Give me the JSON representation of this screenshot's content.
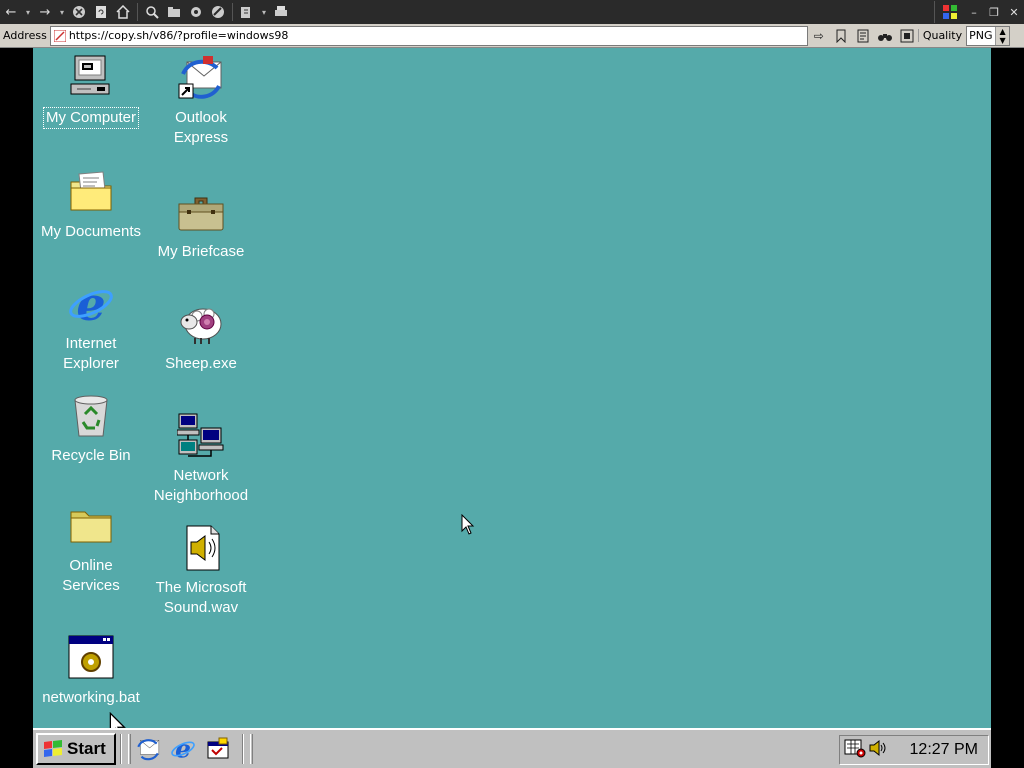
{
  "browser": {
    "address_label": "Address",
    "url": "https://copy.sh/v86/?profile=windows98",
    "quality_label": "Quality",
    "format_value": "PNG"
  },
  "desktop": {
    "icons": [
      {
        "label": "My Computer",
        "icon": "my-computer-icon"
      },
      {
        "label": "Outlook\nExpress",
        "icon": "outlook-express-icon"
      },
      {
        "label": "My Documents",
        "icon": "my-documents-icon"
      },
      {
        "label": "My Briefcase",
        "icon": "briefcase-icon"
      },
      {
        "label": "Internet\nExplorer",
        "icon": "internet-explorer-icon"
      },
      {
        "label": "Sheep.exe",
        "icon": "sheep-icon"
      },
      {
        "label": "Recycle Bin",
        "icon": "recycle-bin-icon"
      },
      {
        "label": "Network\nNeighborhood",
        "icon": "network-neighborhood-icon"
      },
      {
        "label": "Online\nServices",
        "icon": "folder-icon"
      },
      {
        "label": "The Microsoft\nSound.wav",
        "icon": "sound-file-icon"
      },
      {
        "label": "networking.bat",
        "icon": "batch-file-icon"
      }
    ],
    "background_color": "#55aaaa"
  },
  "taskbar": {
    "start_label": "Start",
    "clock": "12:27 PM"
  }
}
